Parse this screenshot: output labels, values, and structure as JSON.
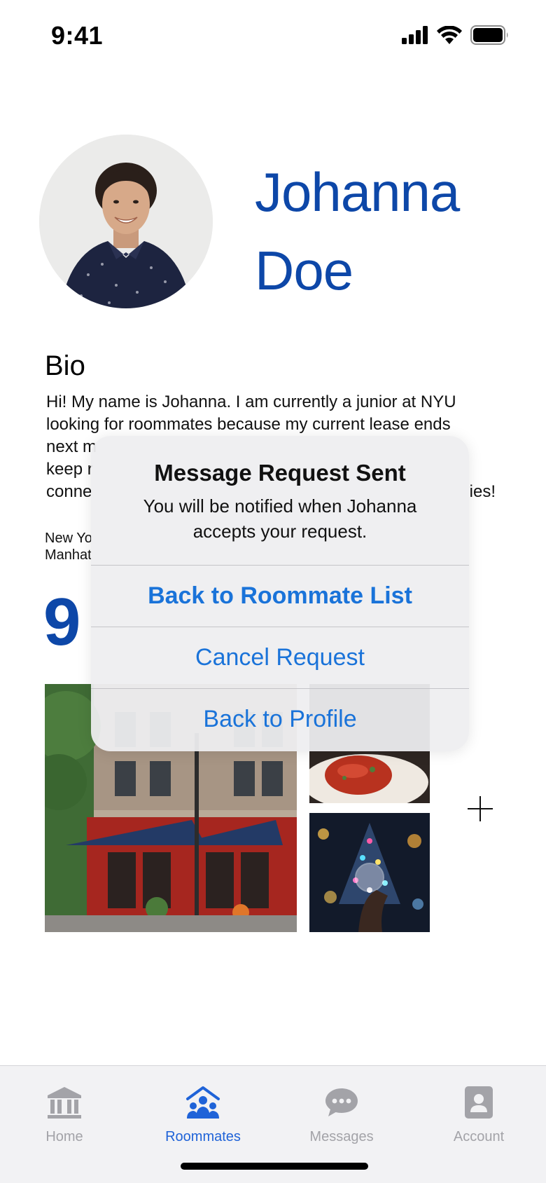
{
  "status_bar": {
    "time": "9:41"
  },
  "profile": {
    "name_first": "Johanna",
    "name_last": "Doe"
  },
  "bio": {
    "heading": "Bio",
    "text": "Hi! My name is Johanna. I am currently a junior at NYU looking for roommates because my current lease ends next m… keep r… conne… ies!",
    "text_lines": [
      "Hi! My name is Johanna. I am currently a junior at NYU",
      "looking for roommates because my current lease ends",
      "next m",
      "keep r",
      "conne",
      "ies!"
    ],
    "location_lines": [
      "New Yo",
      "Manhat"
    ]
  },
  "big_number": "9",
  "alert": {
    "title": "Message Request Sent",
    "message": "You will be notified when Johanna accepts your request.",
    "buttons": [
      {
        "label": "Back to Roommate List"
      },
      {
        "label": "Cancel Request"
      },
      {
        "label": "Back to Profile"
      }
    ]
  },
  "tab_bar": {
    "tabs": [
      {
        "label": "Home",
        "icon": "bank-icon",
        "active": false
      },
      {
        "label": "Roommates",
        "icon": "people-house-icon",
        "active": true
      },
      {
        "label": "Messages",
        "icon": "chat-bubble-icon",
        "active": false
      },
      {
        "label": "Account",
        "icon": "person-badge-icon",
        "active": false
      }
    ]
  },
  "colors": {
    "accent": "#0d47a8",
    "alert_button": "#1a73d9",
    "tab_active": "#1f63d8",
    "tab_inactive": "#a3a3a8"
  }
}
